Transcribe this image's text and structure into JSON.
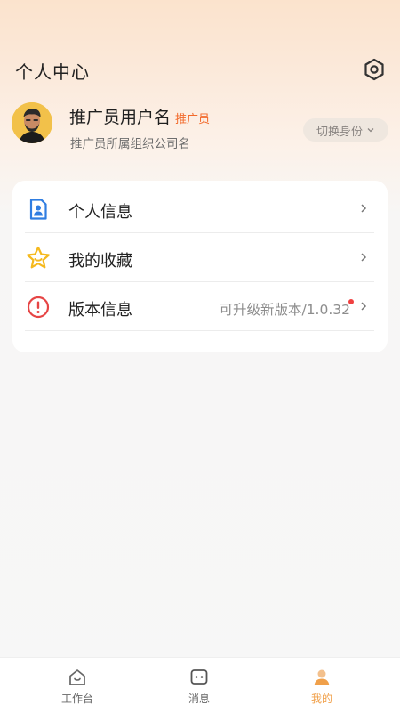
{
  "header": {
    "title": "个人中心",
    "settings_icon": "settings-hexagon-icon"
  },
  "profile": {
    "user_name": "推广员用户名",
    "role_tag": "推广员",
    "org_name": "推广员所属组织公司名",
    "switch_label": "切换身份",
    "switch_icon": "chevron-down-icon"
  },
  "menu": {
    "items": [
      {
        "label": "个人信息",
        "icon": "id-card-icon"
      },
      {
        "label": "我的收藏",
        "icon": "star-icon"
      },
      {
        "label": "版本信息",
        "icon": "info-circle-icon",
        "value": "可升级新版本/1.0.32"
      }
    ]
  },
  "tabbar": {
    "tabs": [
      {
        "label": "工作台",
        "icon": "home-icon",
        "active": false
      },
      {
        "label": "消息",
        "icon": "message-icon",
        "active": false
      },
      {
        "label": "我的",
        "icon": "profile-icon",
        "active": true
      }
    ]
  },
  "colors": {
    "accent": "#f0a04a",
    "role_tag": "#f26a2b",
    "id_icon": "#2f7de1",
    "star_icon": "#f5b91e",
    "info_icon": "#e64545",
    "notification_dot": "#f04040"
  }
}
